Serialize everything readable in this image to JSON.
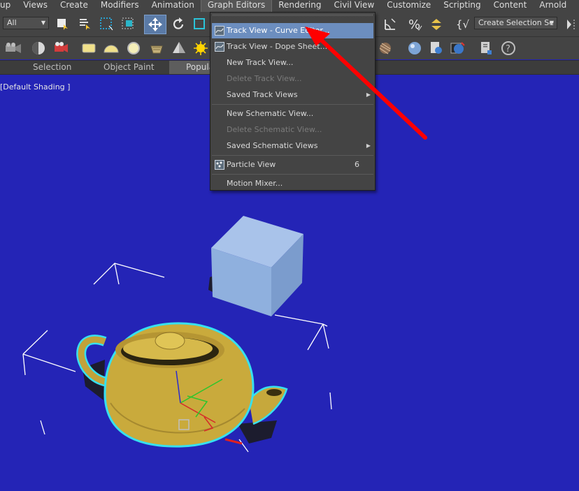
{
  "menubar": {
    "items": [
      "up",
      "Views",
      "Create",
      "Modifiers",
      "Animation",
      "Graph Editors",
      "Rendering",
      "Civil View",
      "Customize",
      "Scripting",
      "Content",
      "Arnold"
    ]
  },
  "toolbar": {
    "filter_value": "All",
    "selection_set_value": "Create Selection Se"
  },
  "ribbon": {
    "tabs": [
      "Selection",
      "Object Paint",
      "Populate"
    ]
  },
  "viewport": {
    "label": "[Default Shading ]"
  },
  "graph_menu": {
    "items": [
      {
        "label": "Track View - Curve Editor...",
        "highlighted": true
      },
      {
        "label": "Track View - Dope Sheet..."
      },
      {
        "label": "New Track View..."
      },
      {
        "label": "Delete Track View..."
      },
      {
        "label": "Saved Track Views"
      },
      {
        "label": "New Schematic View..."
      },
      {
        "label": "Delete Schematic View..."
      },
      {
        "label": "Saved Schematic Views"
      },
      {
        "label": "Particle View",
        "shortcut": "6"
      },
      {
        "label": "Motion Mixer..."
      }
    ]
  },
  "colors": {
    "viewport_bg": "#2424b6",
    "menu_highlight": "#6c8ebf",
    "annotation_arrow": "#ff0000",
    "teapot": "#c9aa3c",
    "box": "#8fb0de"
  },
  "icons": [
    "select-move-icon",
    "rotate-icon",
    "track-view-icon",
    "particle-view-icon",
    "submenu-arrow-icon"
  ]
}
